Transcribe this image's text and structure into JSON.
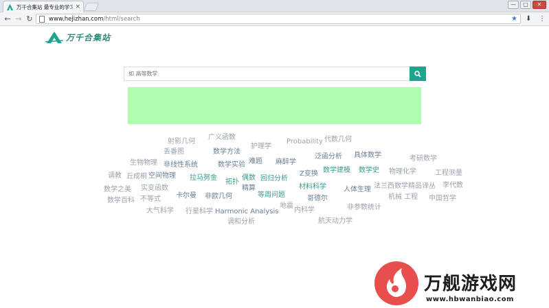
{
  "browser": {
    "tab_title": "万千合集站 最专业的学习",
    "tab_close": "×",
    "url_host": "www.hejizhan.com",
    "url_path": "/html/search",
    "window_buttons": [
      "—",
      "□",
      "✕"
    ]
  },
  "site": {
    "logo_text": "万千合集站",
    "brand_color": "#1fa58f"
  },
  "search": {
    "placeholder": "如 高等数学",
    "button_icon": "search-icon"
  },
  "tag_cloud": [
    "射影几何",
    "广义函数",
    "Probability",
    "代数几何",
    "丢番图",
    "数学方法",
    "护理学",
    "泛函分析",
    "具体数学",
    "考研数学",
    "生物物理",
    "非线性系统",
    "数学实验",
    "难题",
    "麻醉学",
    "Z变换",
    "数学建模",
    "数学史",
    "物理化学",
    "工程测量",
    "调教",
    "丘成桐",
    "空间物理",
    "拉马努金",
    "拓扑",
    "偶数",
    "回归分析",
    "材料科学",
    "法兰西数学精品译丛",
    "李代数",
    "数学之美",
    "实变函数",
    "精算",
    "等周问题",
    "人体生理",
    "机械 工程",
    "中国哲学",
    "数学百科",
    "不等式",
    "卡尔曼",
    "非欧几何",
    "地震",
    "哥德尔",
    "非参数统计",
    "大气科学",
    "行星科学",
    "Harmonic Analysis",
    "内科学",
    "调和分析",
    "航天动力学"
  ],
  "watermark": {
    "title": "万舰游戏网",
    "url": "www.hbwanbiao.com"
  }
}
